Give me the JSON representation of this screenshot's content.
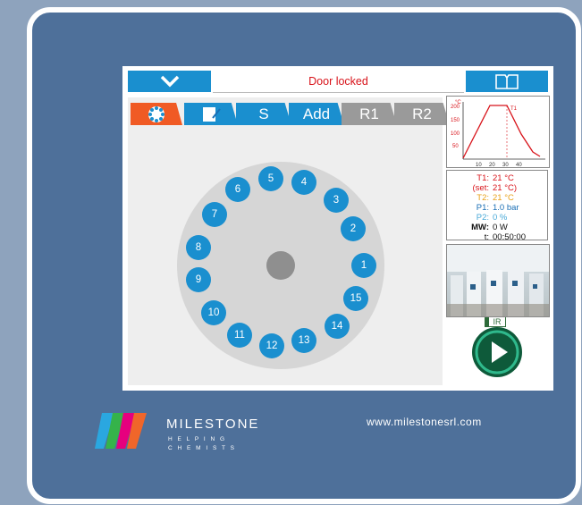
{
  "status": {
    "text": "Door locked"
  },
  "tabs": [
    {
      "id": "rotor",
      "label": ""
    },
    {
      "id": "edit",
      "label": ""
    },
    {
      "id": "s",
      "label": "S"
    },
    {
      "id": "add",
      "label": "Add"
    },
    {
      "id": "r1",
      "label": "R1"
    },
    {
      "id": "r2",
      "label": "R2"
    }
  ],
  "vessels": [
    "1",
    "2",
    "3",
    "4",
    "5",
    "6",
    "7",
    "8",
    "9",
    "10",
    "11",
    "12",
    "13",
    "14",
    "15"
  ],
  "ir_label": "IR",
  "temp_graph": {
    "unit": "°C",
    "series_label": "T1",
    "y_ticks": [
      "200",
      "150",
      "100",
      "50"
    ],
    "x_ticks": [
      "10",
      "20",
      "30",
      "40"
    ]
  },
  "readings": [
    {
      "label": "T1:",
      "value": "21 °C",
      "color": "#d8131a"
    },
    {
      "label": "(set:",
      "value": "21 °C)",
      "color": "#d8131a"
    },
    {
      "label": "T2:",
      "value": "21 °C",
      "color": "#e8a11a"
    },
    {
      "label": "P1:",
      "value": "1.0 bar",
      "color": "#1a6fb5"
    },
    {
      "label": "P2:",
      "value": "0 %",
      "color": "#49a9d8"
    },
    {
      "label": "MW:",
      "value": "0 W",
      "color": "#111111"
    },
    {
      "label": "t:",
      "value": "00:50:00",
      "color": "#111111"
    }
  ],
  "brand": {
    "name": "MILESTONE",
    "tagline1": "H E L P I N G",
    "tagline2": "C H E M I S T S"
  },
  "website": "www.milestonesrl.com",
  "colors": {
    "accent": "#1a8fcf",
    "active_tab": "#f05a24",
    "start_green": "#0e5a3a",
    "status_red": "#d8131a"
  }
}
